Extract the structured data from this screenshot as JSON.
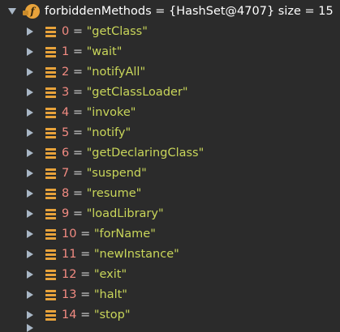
{
  "root": {
    "text": "forbiddenMethods = {HashSet@4707}  size = 15",
    "icon": "field-icon",
    "icon_glyph": "f",
    "expanded": true
  },
  "items": [
    {
      "index": "0",
      "value": "\"getClass\""
    },
    {
      "index": "1",
      "value": "\"wait\""
    },
    {
      "index": "2",
      "value": "\"notifyAll\""
    },
    {
      "index": "3",
      "value": "\"getClassLoader\""
    },
    {
      "index": "4",
      "value": "\"invoke\""
    },
    {
      "index": "5",
      "value": "\"notify\""
    },
    {
      "index": "6",
      "value": "\"getDeclaringClass\""
    },
    {
      "index": "7",
      "value": "\"suspend\""
    },
    {
      "index": "8",
      "value": "\"resume\""
    },
    {
      "index": "9",
      "value": "\"loadLibrary\""
    },
    {
      "index": "10",
      "value": "\"forName\""
    },
    {
      "index": "11",
      "value": "\"newInstance\""
    },
    {
      "index": "12",
      "value": "\"exit\""
    },
    {
      "index": "13",
      "value": "\"halt\""
    },
    {
      "index": "14",
      "value": "\"stop\""
    }
  ],
  "equals": "=",
  "colors": {
    "background": "#2b2b2b",
    "index": "#f28b82",
    "string": "#c9d65a",
    "icon": "#e8a33b",
    "arrow": "#a9b7c6"
  }
}
